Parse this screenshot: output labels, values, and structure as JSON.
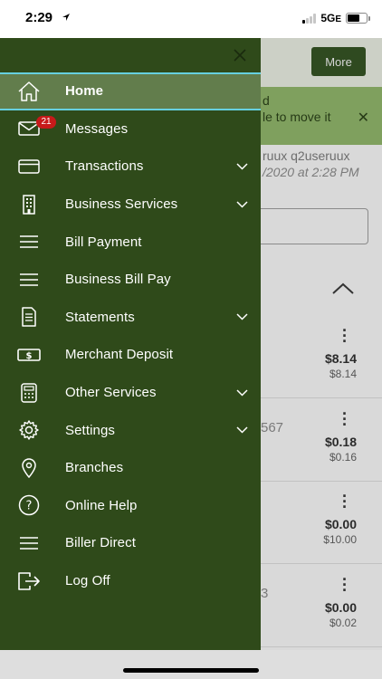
{
  "status": {
    "time": "2:29",
    "network": "5G",
    "network_suffix": "E"
  },
  "background": {
    "more_label": "More",
    "banner_text": "d\nle to move it",
    "user_text": "ruux q2useruux",
    "date_text": "/2020 at 2:28 PM",
    "accounts": [
      {
        "fragment": "",
        "amount": "$8.14",
        "sub": "$8.14"
      },
      {
        "fragment": "567",
        "amount": "$0.18",
        "sub": "$0.16"
      },
      {
        "fragment": "",
        "amount": "$0.00",
        "sub": "$10.00"
      },
      {
        "fragment": "3",
        "amount": "$0.00",
        "sub": "$0.02"
      }
    ]
  },
  "drawer": {
    "items": [
      {
        "label": "Home",
        "icon": "home-icon",
        "active": true,
        "expandable": false
      },
      {
        "label": "Messages",
        "icon": "envelope-icon",
        "badge": "21",
        "expandable": false
      },
      {
        "label": "Transactions",
        "icon": "card-icon",
        "expandable": true
      },
      {
        "label": "Business Services",
        "icon": "building-icon",
        "expandable": true
      },
      {
        "label": "Bill Payment",
        "icon": "list-icon",
        "expandable": false
      },
      {
        "label": "Business Bill Pay",
        "icon": "list-icon",
        "expandable": false
      },
      {
        "label": "Statements",
        "icon": "document-icon",
        "expandable": true
      },
      {
        "label": "Merchant Deposit",
        "icon": "cash-icon",
        "expandable": false
      },
      {
        "label": "Other Services",
        "icon": "calculator-icon",
        "expandable": true
      },
      {
        "label": "Settings",
        "icon": "gear-icon",
        "expandable": true
      },
      {
        "label": "Branches",
        "icon": "location-pin-icon",
        "expandable": false
      },
      {
        "label": "Online Help",
        "icon": "help-icon",
        "expandable": false
      },
      {
        "label": "Biller Direct",
        "icon": "list-icon",
        "expandable": false
      },
      {
        "label": "Log Off",
        "icon": "logout-icon",
        "expandable": false
      }
    ]
  },
  "colors": {
    "drawer_bg": "#2f4a1a",
    "active_bg": "#627d4c",
    "active_border": "#66d0e0",
    "badge": "#c61a1a"
  }
}
